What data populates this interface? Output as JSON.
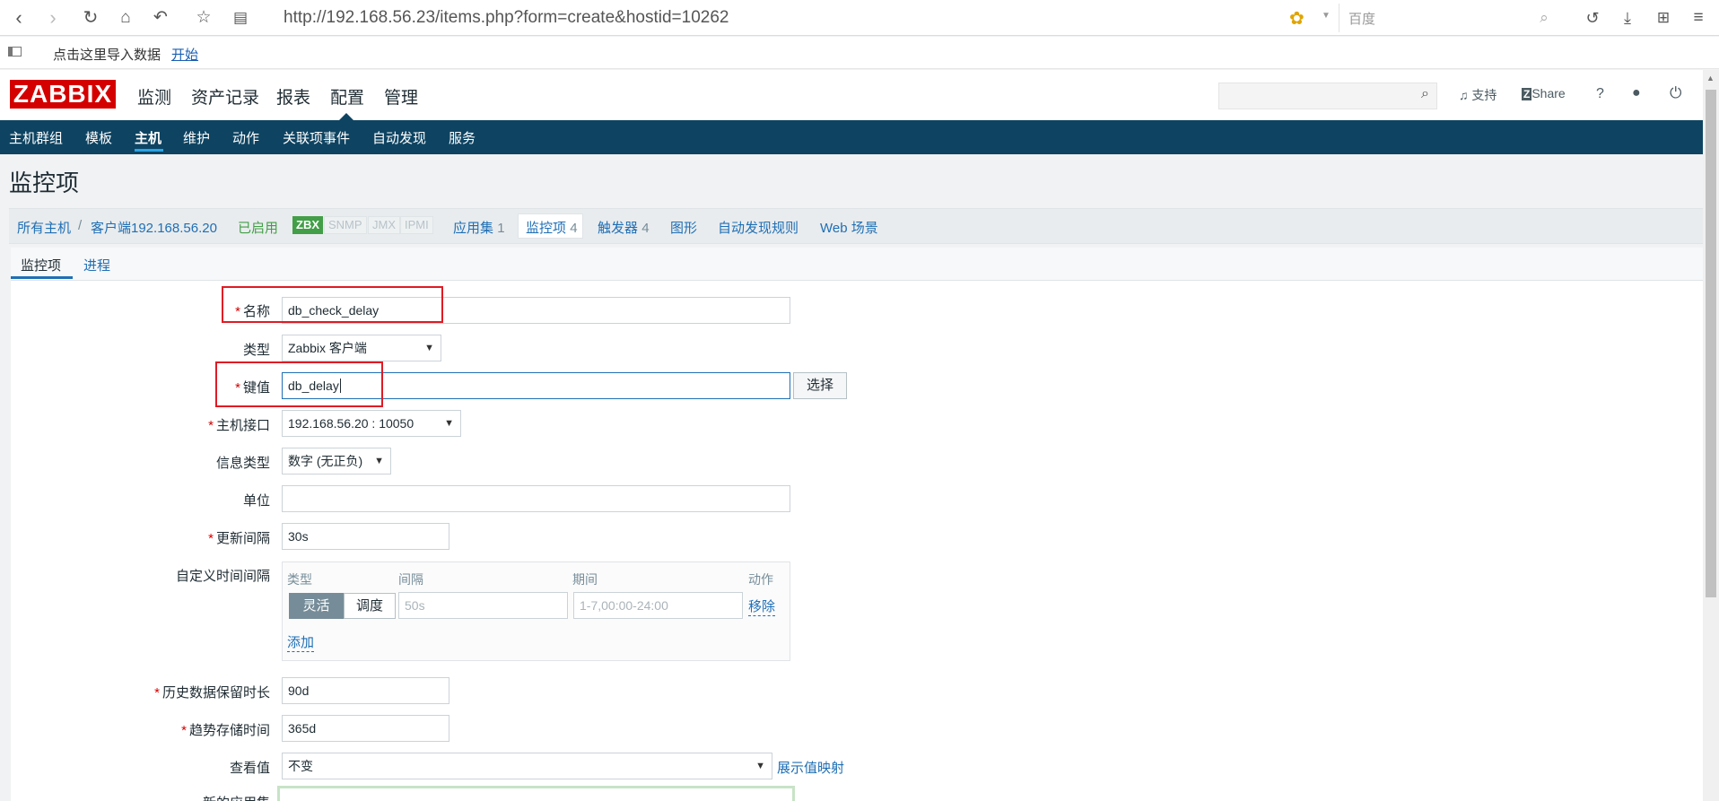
{
  "browser": {
    "url": "http://192.168.56.23/items.php?form=create&hostid=10262",
    "search_placeholder": "百度",
    "bookmark_text": "点击这里导入数据",
    "bookmark_link": "开始"
  },
  "header": {
    "logo": "ZABBIX",
    "menu": [
      "监测",
      "资产记录",
      "报表",
      "配置",
      "管理"
    ],
    "active_menu": "配置",
    "support": "支持",
    "share": "Share",
    "help": "?"
  },
  "subnav": [
    "主机群组",
    "模板",
    "主机",
    "维护",
    "动作",
    "关联项事件",
    "自动发现",
    "服务"
  ],
  "page_title": "监控项",
  "host_nav": {
    "all_hosts": "所有主机",
    "sep": "/",
    "host": "客户端192.168.56.20",
    "status": "已启用",
    "zbx": "ZBX",
    "snmp": "SNMP",
    "jmx": "JMX",
    "ipmi": "IPMI",
    "apps": "应用集",
    "apps_count": "1",
    "items": "监控项",
    "items_count": "4",
    "triggers": "触发器",
    "triggers_count": "4",
    "graphs": "图形",
    "discovery": "自动发现规则",
    "web": "Web 场景"
  },
  "tabs": [
    "监控项",
    "进程"
  ],
  "form": {
    "name_label": "名称",
    "name_value": "db_check_delay",
    "type_label": "类型",
    "type_value": "Zabbix 客户端",
    "key_label": "键值",
    "key_value": "db_delay",
    "select_button": "选择",
    "interface_label": "主机接口",
    "interface_value": "192.168.56.20 : 10050",
    "info_type_label": "信息类型",
    "info_type_value": "数字 (无正负)",
    "units_label": "单位",
    "units_value": "",
    "interval_label": "更新间隔",
    "interval_value": "30s",
    "custom_label": "自定义时间间隔",
    "custom": {
      "col_type": "类型",
      "col_interval": "间隔",
      "col_period": "期间",
      "col_action": "动作",
      "flexible": "灵活",
      "scheduling": "调度",
      "interval_placeholder": "50s",
      "period_placeholder": "1-7,00:00-24:00",
      "remove": "移除",
      "add": "添加"
    },
    "history_label": "历史数据保留时长",
    "history_value": "90d",
    "trends_label": "趋势存储时间",
    "trends_value": "365d",
    "valuemap_label": "查看值",
    "valuemap_value": "不变",
    "valuemap_link": "展示值映射",
    "new_app_label": "新的应用集"
  },
  "colors": {
    "accent": "#0e4462",
    "logo": "#d40000",
    "link": "#1f6fb5",
    "enabled": "#429e47",
    "highlight": "#e01b24"
  }
}
